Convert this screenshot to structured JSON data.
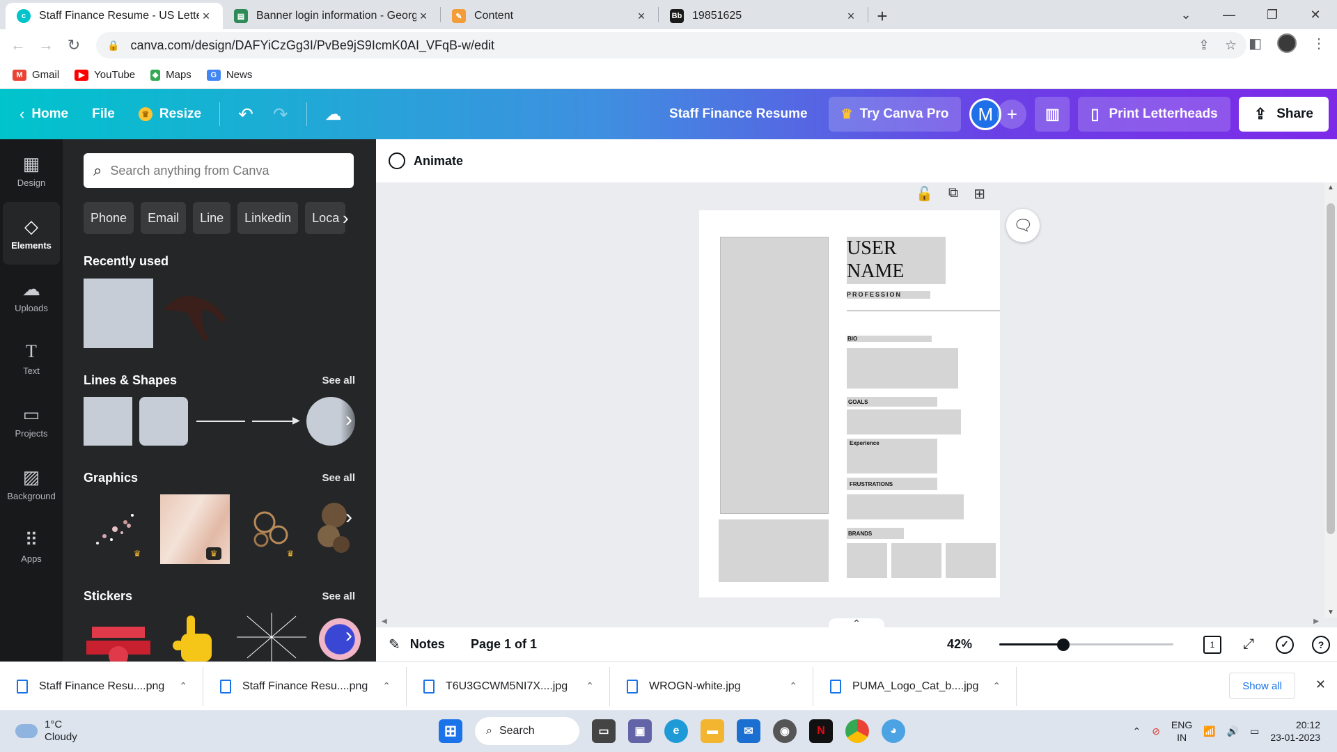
{
  "browser": {
    "tabs": [
      {
        "title": "Staff Finance Resume - US Letter",
        "favicon_color": "#00c4cc",
        "active": true
      },
      {
        "title": "Banner login information - Georg",
        "favicon_color": "#2e8b57",
        "active": false
      },
      {
        "title": "Content",
        "favicon_color": "#f29d38",
        "active": false
      },
      {
        "title": "19851625",
        "favicon_color": "#1a1a1a",
        "favicon_text": "Bb",
        "active": false
      }
    ],
    "url": "canva.com/design/DAFYiCzGg3I/PvBe9jS9IcmK0AI_VFqB-w/edit",
    "bookmarks": [
      {
        "label": "Gmail",
        "color": "#ea4335",
        "glyph": "M"
      },
      {
        "label": "YouTube",
        "color": "#ff0000",
        "glyph": "▶"
      },
      {
        "label": "Maps",
        "color": "#34a853",
        "glyph": "◆"
      },
      {
        "label": "News",
        "color": "#4285f4",
        "glyph": "G"
      }
    ]
  },
  "canva_header": {
    "home": "Home",
    "file": "File",
    "resize": "Resize",
    "design_title": "Staff Finance Resume",
    "try_pro": "Try Canva Pro",
    "avatar_letter": "M",
    "print_letterheads": "Print Letterheads",
    "share": "Share"
  },
  "rail": [
    {
      "label": "Design",
      "icon": "design-icon",
      "glyph": "▦"
    },
    {
      "label": "Elements",
      "icon": "elements-icon",
      "glyph": "◇",
      "active": true
    },
    {
      "label": "Uploads",
      "icon": "upload-cloud-icon",
      "glyph": "☁"
    },
    {
      "label": "Text",
      "icon": "text-icon",
      "glyph": "T"
    },
    {
      "label": "Projects",
      "icon": "folder-icon",
      "glyph": "▭"
    },
    {
      "label": "Background",
      "icon": "background-icon",
      "glyph": "▨"
    },
    {
      "label": "Apps",
      "icon": "apps-grid-icon",
      "glyph": "⠿"
    }
  ],
  "panel": {
    "search_placeholder": "Search anything from Canva",
    "chips": [
      "Phone",
      "Email",
      "Line",
      "Linkedin",
      "Loca"
    ],
    "recently_used": "Recently used",
    "lines_shapes": "Lines & Shapes",
    "graphics": "Graphics",
    "stickers": "Stickers",
    "see_all": "See all"
  },
  "editor": {
    "animate": "Animate",
    "resume": {
      "name_line1": "USER",
      "name_line2": "NAME",
      "profession": "PROFESSION",
      "bio": "BIO",
      "goals": "GOALS",
      "experience": "Experience",
      "frustrations": "FRUSTRATIONS",
      "brands": "BRANDS"
    },
    "notes": "Notes",
    "page_info": "Page 1 of 1",
    "zoom": "42%",
    "zoom_level": 0.42,
    "page_count": "1"
  },
  "downloads": {
    "items": [
      "Staff Finance Resu....png",
      "Staff Finance Resu....png",
      "T6U3GCWM5NI7X....jpg",
      "WROGN-white.jpg",
      "PUMA_Logo_Cat_b....jpg"
    ],
    "show_all": "Show all"
  },
  "taskbar": {
    "temperature": "1°C",
    "weather": "Cloudy",
    "search": "Search",
    "lang1": "ENG",
    "lang2": "IN",
    "time": "20:12",
    "date": "23-01-2023"
  }
}
